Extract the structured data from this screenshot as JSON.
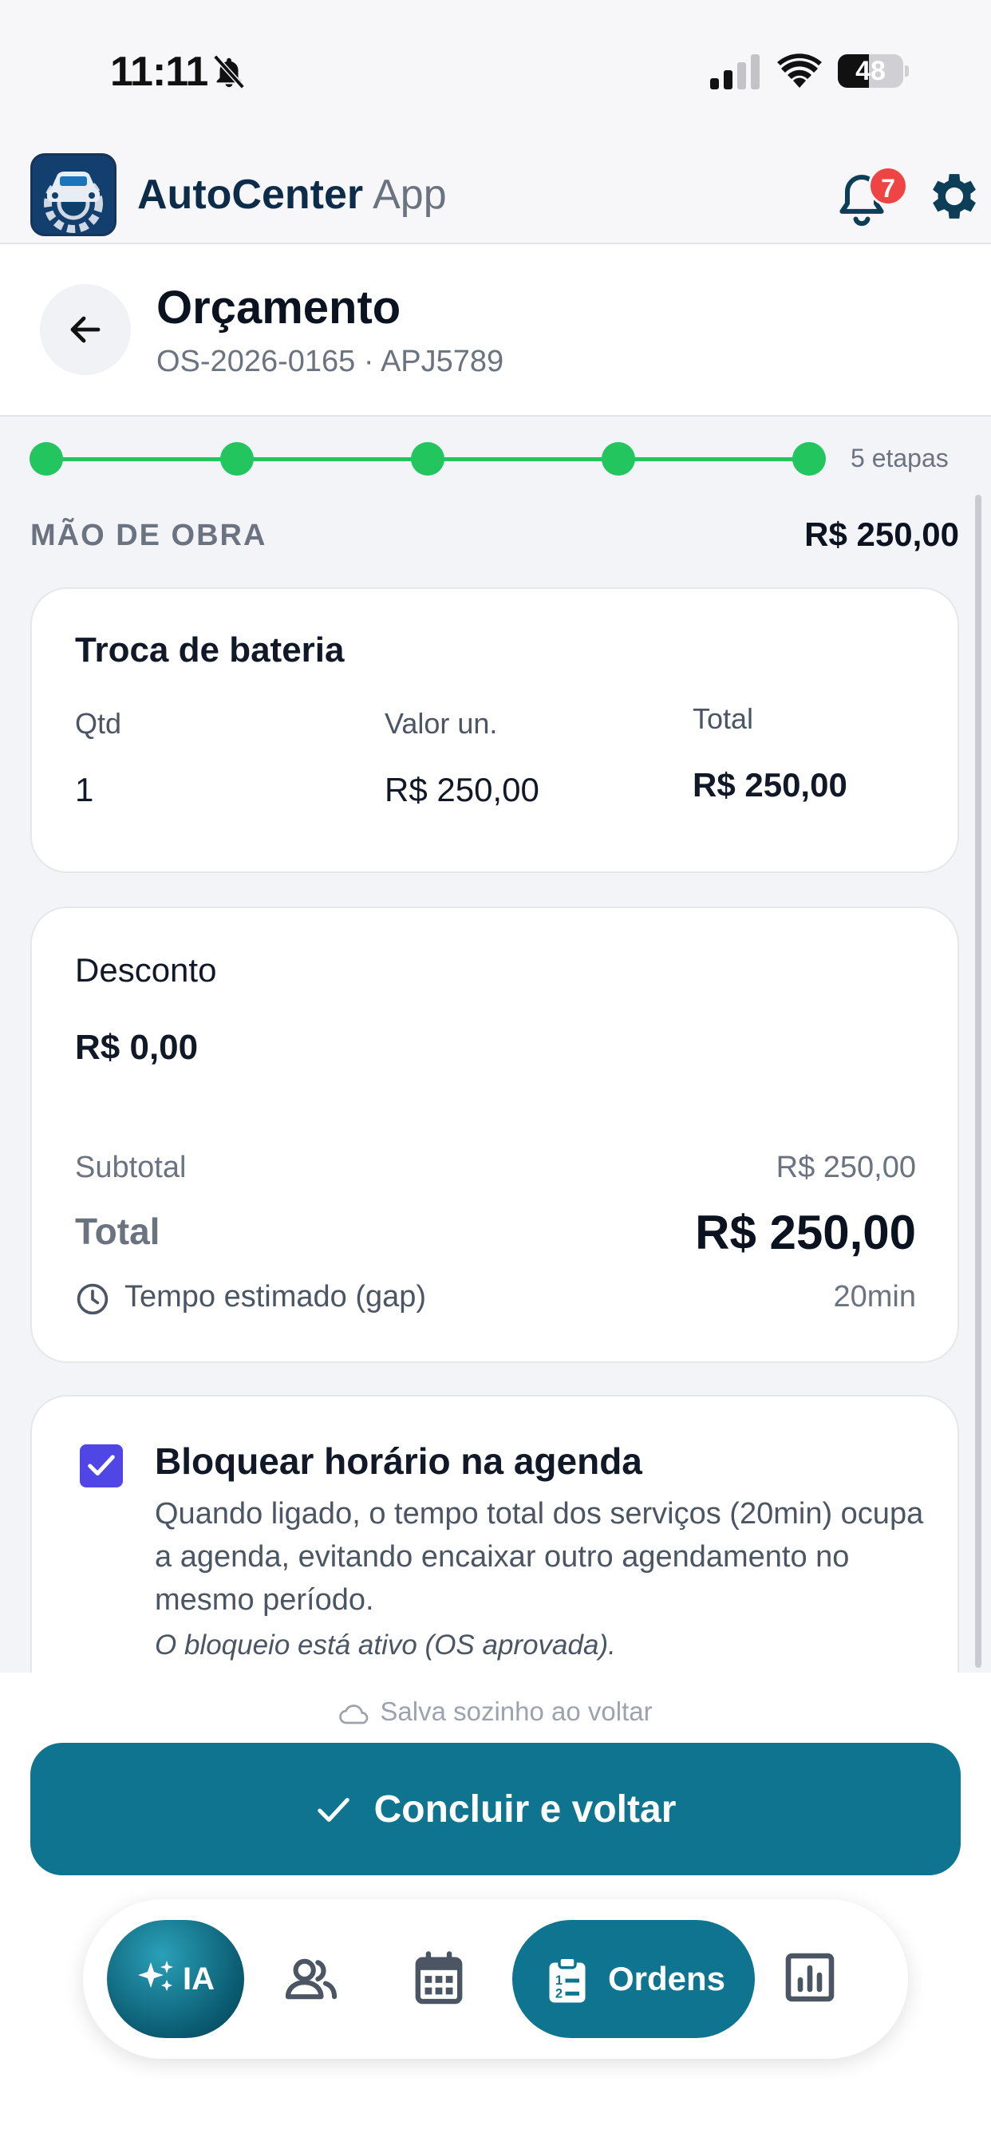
{
  "status_bar": {
    "time": "11:11",
    "battery": "48",
    "battery_level": 0.48
  },
  "header": {
    "brand_name": "AutoCenter",
    "brand_suffix": "App",
    "notification_count": "7"
  },
  "page": {
    "title": "Orçamento",
    "subtitle": "OS-2026-0165 · APJ5789"
  },
  "stepper": {
    "steps": 5,
    "completed": 5,
    "label": "5 etapas"
  },
  "labor": {
    "section_title": "MÃO DE OBRA",
    "section_total": "R$ 250,00",
    "service": {
      "name": "Troca de bateria",
      "qty_label": "Qtd",
      "qty": "1",
      "unit_label": "Valor un.",
      "unit_value": "R$ 250,00",
      "total_label": "Total",
      "total_value": "R$ 250,00"
    }
  },
  "summary": {
    "discount_label": "Desconto",
    "discount_value": "R$ 0,00",
    "subtotal_label": "Subtotal",
    "subtotal_value": "R$ 250,00",
    "total_label": "Total",
    "total_value": "R$ 250,00",
    "time_label": "Tempo estimado (gap)",
    "time_value": "20min"
  },
  "schedule_block": {
    "checked": true,
    "title": "Bloquear horário na agenda",
    "description": "Quando ligado, o tempo total dos serviços (20min) ocupa a agenda, evitando encaixar outro agendamento no mesmo período.",
    "note": "O bloqueio está ativo (OS aprovada)."
  },
  "footer": {
    "autosave": "Salva sozinho ao voltar",
    "primary_button": "Concluir e voltar"
  },
  "tabbar": {
    "ia": "IA",
    "ordens": "Ordens",
    "icons": [
      "sparkles-icon",
      "users-icon",
      "calendar-icon",
      "clipboard-list-icon",
      "bar-chart-icon"
    ]
  },
  "colors": {
    "primary": "#0e7490",
    "success": "#22c55e",
    "checkbox": "#4f46e5",
    "badge": "#ef4444"
  }
}
